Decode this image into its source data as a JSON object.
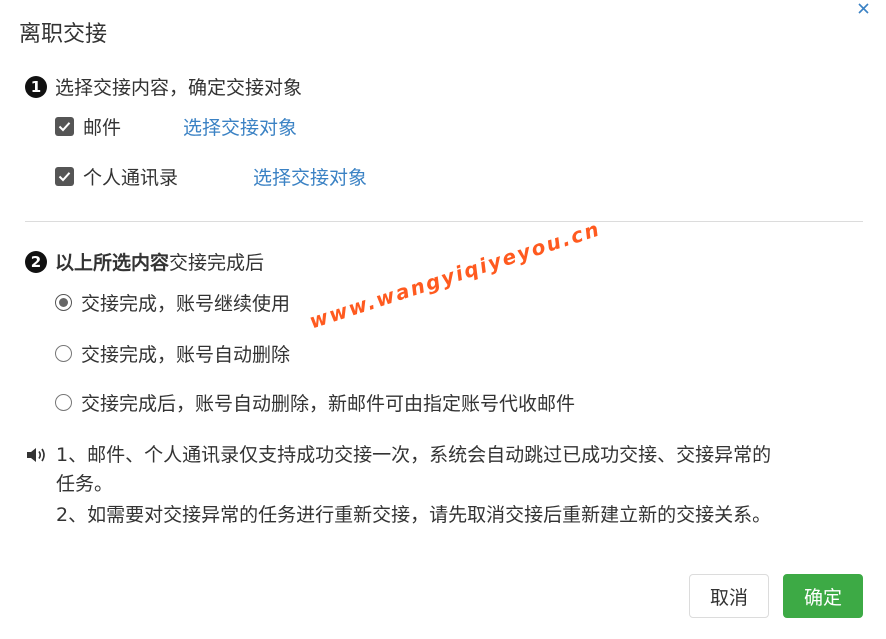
{
  "dialog": {
    "title": "离职交接",
    "close_icon": "close-icon",
    "accent_link_color": "#3b82c4",
    "primary_button_color": "#3daa45"
  },
  "step1": {
    "number": "1",
    "heading": "选择交接内容，确定交接对象",
    "items": [
      {
        "label": "邮件",
        "checked": true,
        "link": "选择交接对象"
      },
      {
        "label": "个人通讯录",
        "checked": true,
        "link": "选择交接对象"
      }
    ]
  },
  "step2": {
    "number": "2",
    "heading_bold": "以上所选内容",
    "heading_rest": "交接完成后",
    "options": [
      {
        "label": "交接完成，账号继续使用",
        "selected": true
      },
      {
        "label": "交接完成，账号自动删除",
        "selected": false
      },
      {
        "label": "交接完成后，账号自动删除，新邮件可由指定账号代收邮件",
        "selected": false
      }
    ]
  },
  "notice": {
    "icon": "speaker-icon",
    "line1": "1、邮件、个人通讯录仅支持成功交接一次，系统会自动跳过已成功交接、交接异常的",
    "line2": "任务。",
    "line3": "2、如需要对交接异常的任务进行重新交接，请先取消交接后重新建立新的交接关系。"
  },
  "watermark": "www.wangyiqiyeyou.cn",
  "buttons": {
    "cancel": "取消",
    "ok": "确定"
  }
}
